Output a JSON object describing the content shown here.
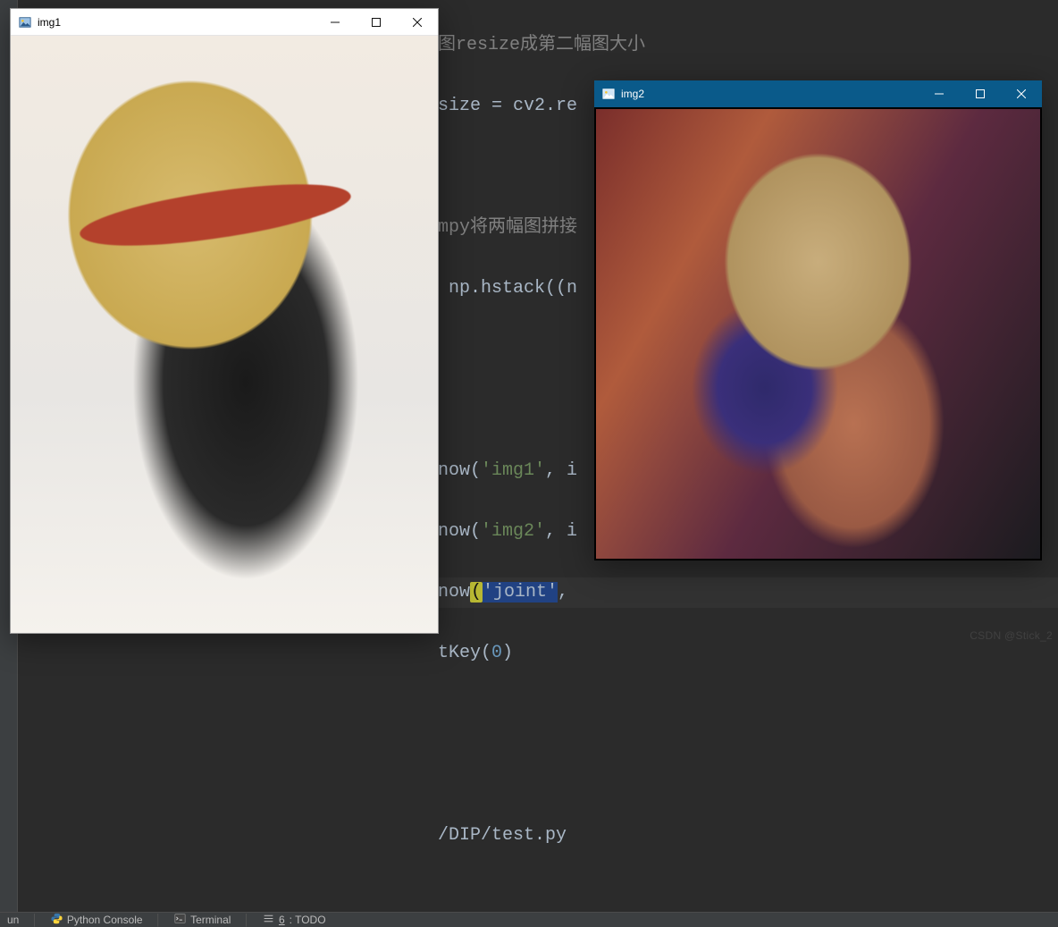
{
  "windows": {
    "img1": {
      "title": "img1",
      "icon": "image-icon",
      "controls": {
        "minimize": "–",
        "maximize": "□",
        "close": "×"
      }
    },
    "img2": {
      "title": "img2",
      "icon": "image-icon",
      "controls": {
        "minimize": "–",
        "maximize": "□",
        "close": "×"
      }
    }
  },
  "editor": {
    "lines": {
      "l1_comment": "图resize成第二幅图大小",
      "l1b": "size = cv2.re",
      "l3_comment": "mpy将两幅图拼接",
      "l3b_pre": " np.hstack((n",
      "l5a": "now(",
      "l5b": "'img1'",
      "l5c": ", i",
      "l6a": "now(",
      "l6b": "'img2'",
      "l6c": ", i",
      "l7a": "now",
      "l7_openp": "(",
      "l7b": "'joint'",
      "l7c": ",",
      "l8a": "tKey(",
      "l8b": "0",
      "l8c": ")",
      "l10": "/DIP/test.py"
    }
  },
  "bottom_bar": {
    "run": "un",
    "python_console": "Python Console",
    "terminal": "Terminal",
    "todo_underline": "6",
    "todo": ": TODO"
  },
  "watermark": "CSDN @Stick_2"
}
